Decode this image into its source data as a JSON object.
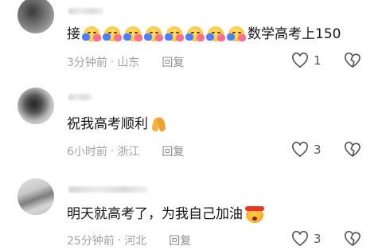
{
  "comments": [
    {
      "text": "接",
      "emoji_name": "hug-emoji",
      "emoji_count": 8,
      "text_after": "数学高考上150",
      "time": "3分钟前",
      "separator": "·",
      "location": "山东",
      "reply_label": "回复",
      "likes": "1"
    },
    {
      "text": "祝我高考顺利",
      "emoji_name": "pray-emoji",
      "time": "6小时前",
      "separator": "·",
      "location": "浙江",
      "reply_label": "回复",
      "likes": "3"
    },
    {
      "text": "明天就高考了，为我自己加油",
      "emoji_name": "determined-face-emoji",
      "time": "25分钟前",
      "separator": "·",
      "location": "河北",
      "reply_label": "回复",
      "likes": "3"
    }
  ],
  "colors": {
    "text": "#161616",
    "meta": "#a3a3a3",
    "icon": "#555555"
  }
}
